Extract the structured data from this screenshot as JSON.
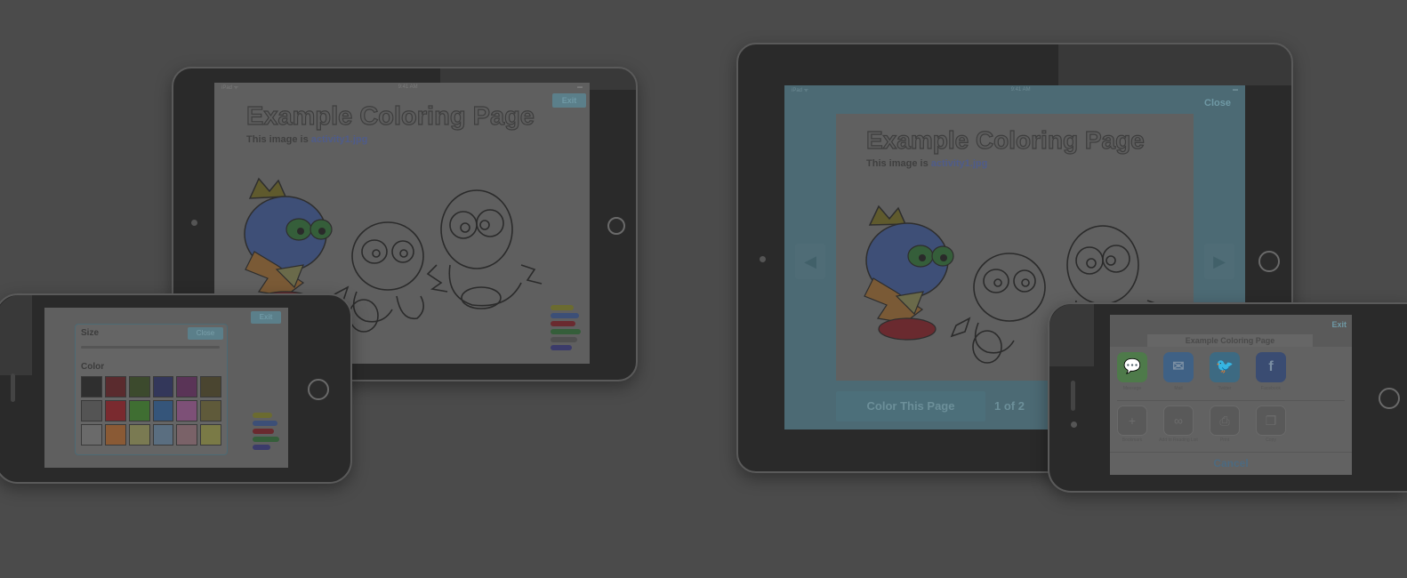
{
  "tablet_mini": {
    "status_left": "iPad ᯤ",
    "status_time": "9:41 AM",
    "exit_label": "Exit",
    "page_title": "Example Coloring Page",
    "subtitle_prefix": "This image is",
    "subtitle_link": "activity1.jpg"
  },
  "tablet_large": {
    "status_left": "iPad ᯤ",
    "status_time": "9:41 AM",
    "close_label": "Close",
    "page_title": "Example Coloring Page",
    "subtitle_prefix": "This image is",
    "subtitle_link": "activity1.jpg",
    "color_button_label": "Color This Page",
    "pager_label": "1 of 2"
  },
  "phone_left": {
    "exit_label": "Exit",
    "size_label": "Size",
    "close_label": "Close",
    "color_label": "Color",
    "swatches": [
      "#2f2f2f",
      "#5a2b2e",
      "#3c4a2d",
      "#33375a",
      "#5a3457",
      "#4a4530",
      "#545454",
      "#7a2a2f",
      "#3f6e32",
      "#35557a",
      "#7d5077",
      "#5f5a3a",
      "#6a6a6a",
      "#8a5a35",
      "#7a7a52",
      "#5a6e80",
      "#7a6268",
      "#7a7a46"
    ]
  },
  "phone_right": {
    "exit_label": "Exit",
    "header_title": "Example Coloring Page",
    "share_targets": [
      {
        "label": "Message",
        "icon": "message-icon",
        "color": "#4e7a4a"
      },
      {
        "label": "Mail",
        "icon": "mail-icon",
        "color": "#3f6185"
      },
      {
        "label": "Twitter",
        "icon": "twitter-icon",
        "color": "#3d6a82"
      },
      {
        "label": "Facebook",
        "icon": "facebook-icon",
        "color": "#3a4c72"
      }
    ],
    "actions": [
      {
        "label": "Bookmark",
        "icon": "bookmark-icon"
      },
      {
        "label": "Add to Reading List",
        "icon": "reading-list-icon"
      },
      {
        "label": "Print",
        "icon": "print-icon"
      },
      {
        "label": "Copy",
        "icon": "copy-icon"
      }
    ],
    "cancel_label": "Cancel"
  }
}
